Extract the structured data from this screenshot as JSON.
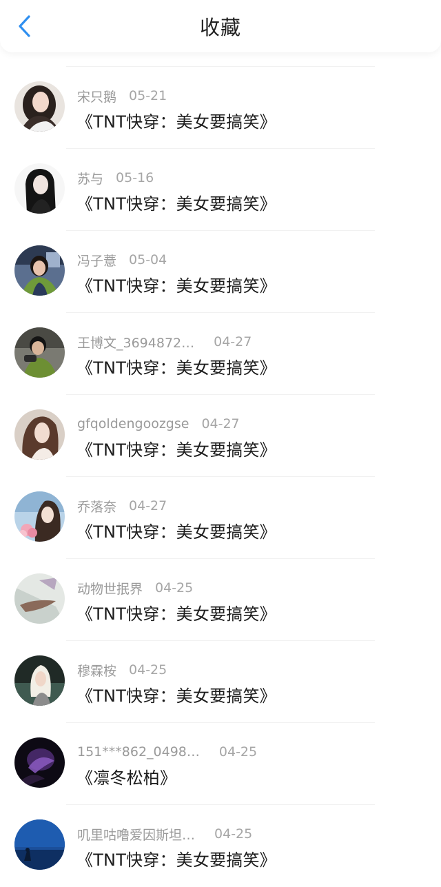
{
  "header": {
    "title": "收藏",
    "back_icon": "chevron-left-icon",
    "accent_color": "#2f8ff0"
  },
  "favorites": [
    {
      "username": "宋只鹅",
      "date": "05-21",
      "title": "《TNT快穿：美女要搞笑》",
      "avatar": "portrait-avatar"
    },
    {
      "username": "苏与",
      "date": "05-16",
      "title": "《TNT快穿：美女要搞笑》",
      "avatar": "portrait-avatar"
    },
    {
      "username": "冯子薏",
      "date": "05-04",
      "title": "《TNT快穿：美女要搞笑》",
      "avatar": "portrait-avatar"
    },
    {
      "username": "王博文_3694872…",
      "date": "04-27",
      "title": "《TNT快穿：美女要搞笑》",
      "avatar": "portrait-avatar"
    },
    {
      "username": "gfqoldengoozgse",
      "date": "04-27",
      "title": "《TNT快穿：美女要搞笑》",
      "avatar": "portrait-avatar"
    },
    {
      "username": "乔落奈",
      "date": "04-27",
      "title": "《TNT快穿：美女要搞笑》",
      "avatar": "portrait-avatar"
    },
    {
      "username": "动物世抿界",
      "date": "04-25",
      "title": "《TNT快穿：美女要搞笑》",
      "avatar": "photo-avatar"
    },
    {
      "username": "穆霖桉",
      "date": "04-25",
      "title": "《TNT快穿：美女要搞笑》",
      "avatar": "portrait-avatar"
    },
    {
      "username": "151***862_0498…",
      "date": "04-25",
      "title": "《凛冬松柏》",
      "avatar": "photo-avatar"
    },
    {
      "username": "叽里咕噜爱因斯坦…",
      "date": "04-25",
      "title": "《TNT快穿：美女要搞笑》",
      "avatar": "photo-avatar"
    }
  ]
}
